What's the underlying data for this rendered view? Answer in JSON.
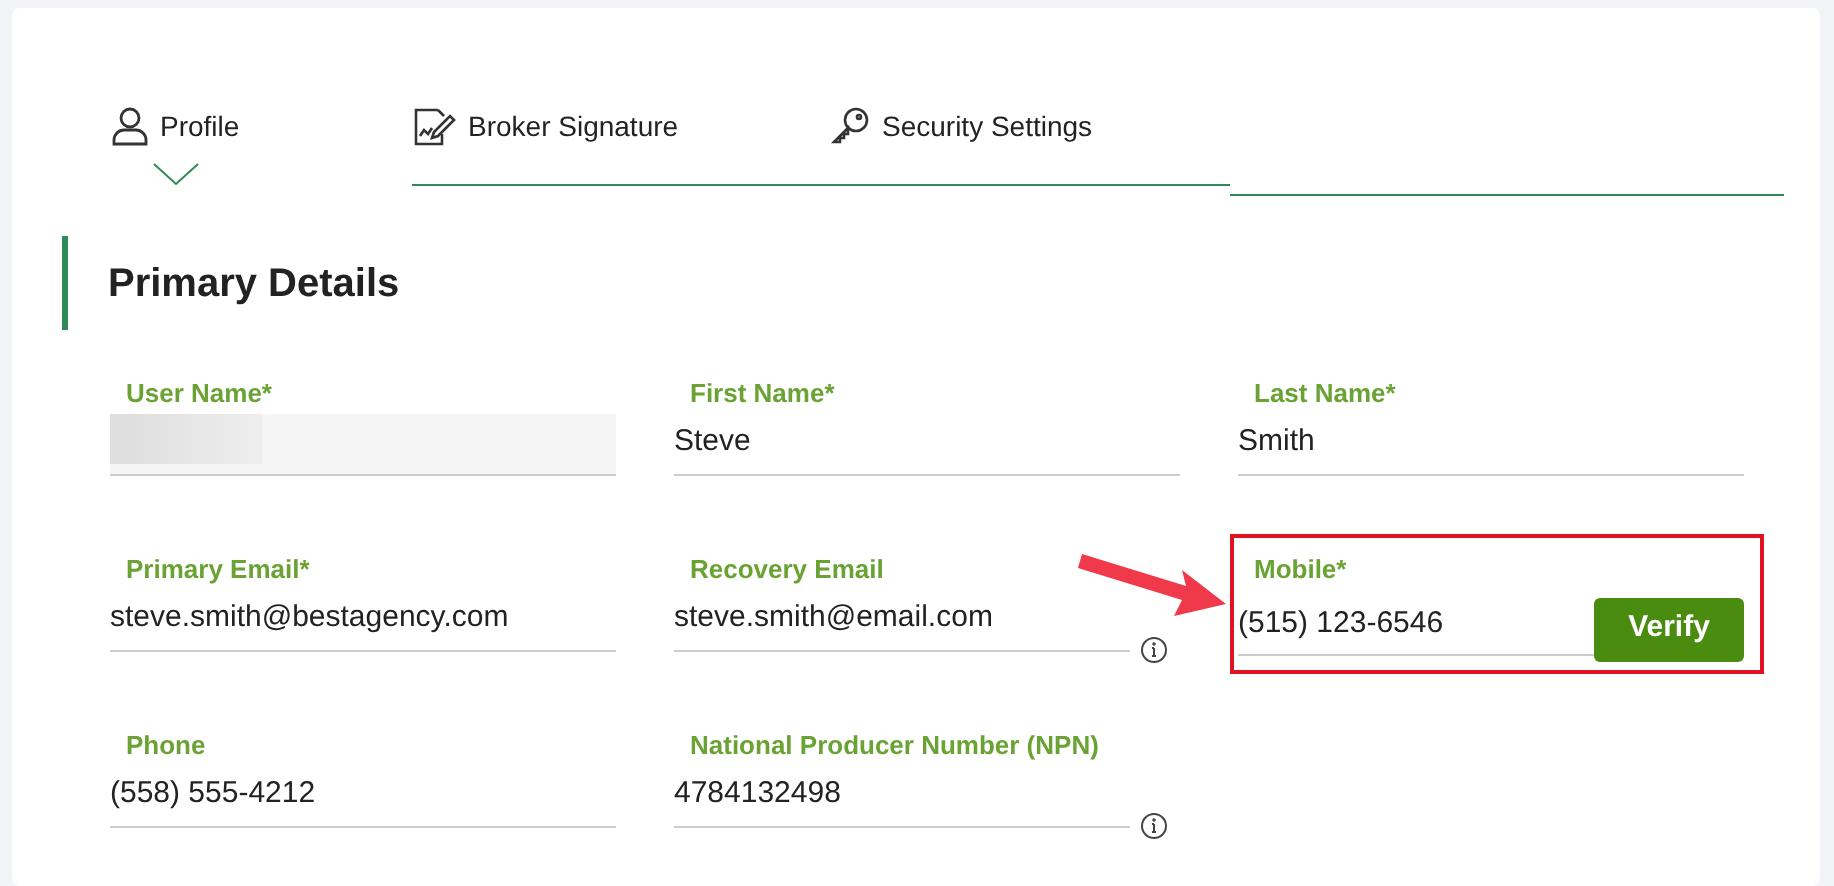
{
  "tabs": [
    {
      "label": "Profile",
      "kind": "person",
      "selected": true
    },
    {
      "label": "Broker Signature",
      "kind": "signature",
      "selected": false
    },
    {
      "label": "Security Settings",
      "kind": "key",
      "selected": false
    }
  ],
  "section": {
    "title": "Primary Details"
  },
  "fields": [
    {
      "label": "User Name*",
      "kind": "redacted"
    },
    {
      "label": "First Name*",
      "kind": "text",
      "value": "Steve"
    },
    {
      "label": "Last Name*",
      "kind": "text",
      "value": "Smith"
    },
    {
      "label": "Primary Email*",
      "kind": "text",
      "value": "steve.smith@bestagency.com"
    },
    {
      "label": "Recovery Email",
      "kind": "info",
      "value": "steve.smith@email.com"
    },
    {
      "label": "Mobile*",
      "kind": "button",
      "value": "(515) 123-6546",
      "button": "Verify",
      "highlighted": true
    },
    {
      "label": "Phone",
      "kind": "text",
      "value": "(558) 555-4212"
    },
    {
      "label": "National Producer Number (NPN)",
      "kind": "info",
      "value": "4784132498"
    }
  ]
}
